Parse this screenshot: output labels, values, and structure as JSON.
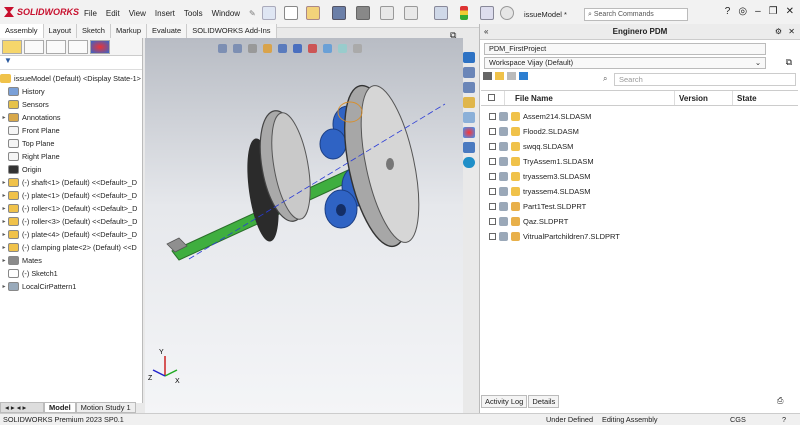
{
  "app": {
    "logo_text": "SOLIDWORKS"
  },
  "menu": [
    "File",
    "Edit",
    "View",
    "Insert",
    "Tools",
    "Window"
  ],
  "toolbar": {
    "model_name": "issueModel *",
    "search_placeholder": "Search Commands"
  },
  "command_tabs": [
    "Assembly",
    "Layout",
    "Sketch",
    "Markup",
    "Evaluate",
    "SOLIDWORKS Add-Ins"
  ],
  "tree": {
    "root": "issueModel (Default) <Display State-1>",
    "items": [
      {
        "label": "History",
        "icon": "history-icon",
        "expand": ""
      },
      {
        "label": "Sensors",
        "icon": "sensors-icon",
        "expand": ""
      },
      {
        "label": "Annotations",
        "icon": "annotations-icon",
        "expand": "▸"
      },
      {
        "label": "Front Plane",
        "icon": "plane-icon",
        "expand": ""
      },
      {
        "label": "Top Plane",
        "icon": "plane-icon",
        "expand": ""
      },
      {
        "label": "Right Plane",
        "icon": "plane-icon",
        "expand": ""
      },
      {
        "label": "Origin",
        "icon": "origin-icon",
        "expand": ""
      },
      {
        "label": "(-) shaft<1> (Default) <<Default>_D",
        "icon": "part-icon",
        "expand": "▸"
      },
      {
        "label": "(-) plate<1> (Default) <<Default>_D",
        "icon": "part-icon",
        "expand": "▸"
      },
      {
        "label": "(-) roller<1> (Default) <<Default>_D",
        "icon": "part-icon",
        "expand": "▸"
      },
      {
        "label": "(-) roller<3> (Default) <<Default>_D",
        "icon": "part-icon",
        "expand": "▸"
      },
      {
        "label": "(-) plate<4> (Default) <<Default>_D",
        "icon": "part-icon",
        "expand": "▸"
      },
      {
        "label": "(-) clamping plate<2> (Default) <<D",
        "icon": "part-icon",
        "expand": "▸"
      },
      {
        "label": "Mates",
        "icon": "mates-icon",
        "expand": "▸"
      },
      {
        "label": "(-) Sketch1",
        "icon": "sketch-icon",
        "expand": ""
      },
      {
        "label": "LocalCirPattern1",
        "icon": "pattern-icon",
        "expand": "▸"
      }
    ]
  },
  "bottom_tabs": [
    "Model",
    "Motion Study 1"
  ],
  "pdm": {
    "title": "Enginero PDM",
    "project": "PDM_FirstProject",
    "workspace": "Workspace Vijay  (Default)",
    "search_placeholder": "Search",
    "columns": [
      "File Name",
      "Version",
      "State"
    ],
    "files": [
      "Assem214.SLDASM",
      "Flood2.SLDASM",
      "swqq.SLDASM",
      "TryAssem1.SLDASM",
      "tryassem3.SLDASM",
      "tryassem4.SLDASM",
      "Part1Test.SLDPRT",
      "Qaz.SLDPRT",
      "VitrualPartchildren7.SLDPRT"
    ],
    "tabs": [
      "Activity Log",
      "Details"
    ]
  },
  "status": {
    "left": "SOLIDWORKS Premium 2023 SP0.1",
    "state": "Under Defined",
    "mode": "Editing Assembly",
    "units": "CGS"
  },
  "colors": {
    "brand": "#c8102e",
    "shaft": "#3fae3f",
    "roller": "#2f63c4",
    "plate": "#b8b8b8"
  }
}
